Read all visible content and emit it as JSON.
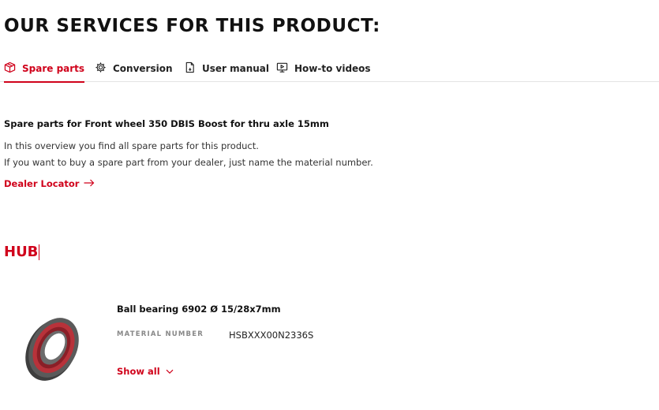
{
  "page": {
    "heading": "OUR SERVICES FOR THIS PRODUCT:"
  },
  "tabs": [
    {
      "label": "Spare parts",
      "icon": "box-icon",
      "active": true
    },
    {
      "label": "Conversion",
      "icon": "gear-icon",
      "active": false
    },
    {
      "label": "User manual",
      "icon": "document-icon",
      "active": false
    },
    {
      "label": "How-to videos",
      "icon": "monitor-icon",
      "active": false
    }
  ],
  "intro": {
    "title": "Spare parts for Front wheel 350 DBIS Boost for thru axle 15mm",
    "line1": "In this overview you find all spare parts for this product.",
    "line2": "If you want to buy a spare part from your dealer, just name the material number.",
    "dealer_link": "Dealer Locator"
  },
  "section": {
    "title": "HUB"
  },
  "parts": [
    {
      "name": "Ball bearing 6902 Ø 15/28x7mm",
      "material_label": "MATERIAL NUMBER",
      "material_number": "HSBXXX00N2336S",
      "show_all": "Show all",
      "image": "ball-bearing-image"
    }
  ],
  "colors": {
    "accent": "#d0021b",
    "text": "#111111",
    "muted": "#888888",
    "divider": "#e4e4e4"
  }
}
